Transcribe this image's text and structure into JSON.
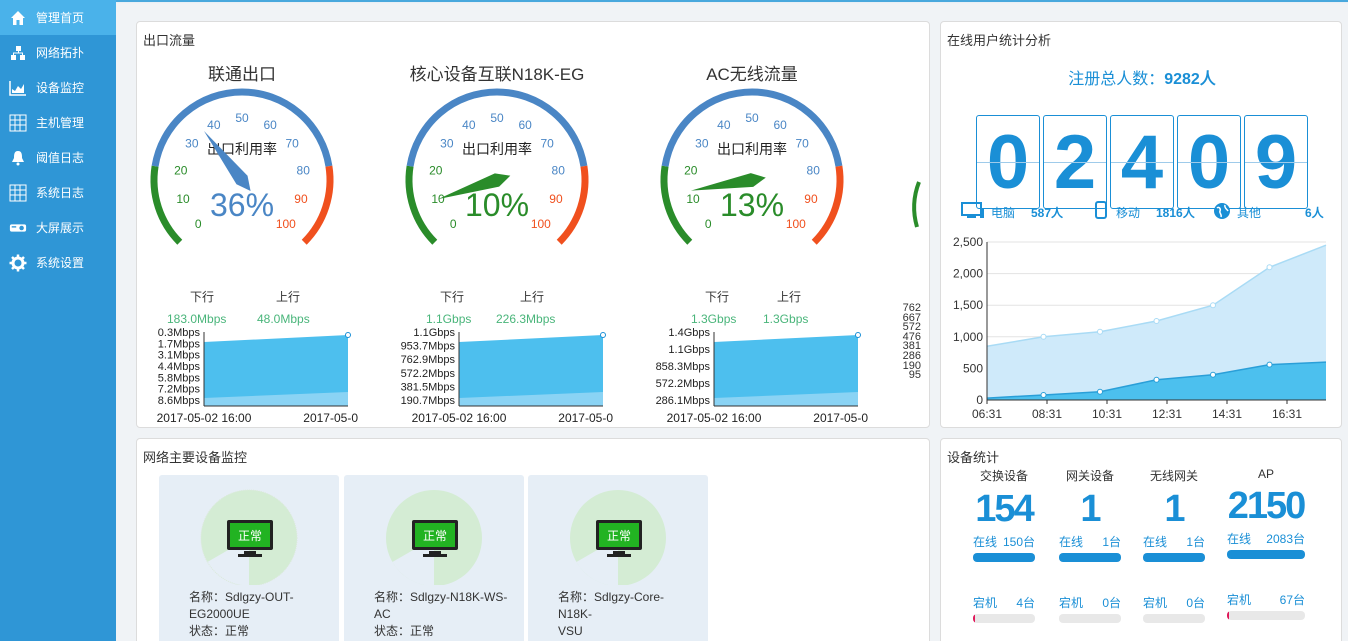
{
  "sidebar": {
    "items": [
      {
        "label": "管理首页",
        "icon": "home-icon",
        "active": true
      },
      {
        "label": "网络拓扑",
        "icon": "topology-icon"
      },
      {
        "label": "设备监控",
        "icon": "chart-icon"
      },
      {
        "label": "主机管理",
        "icon": "grid-icon"
      },
      {
        "label": "阈值日志",
        "icon": "bell-icon"
      },
      {
        "label": "系统日志",
        "icon": "grid-icon"
      },
      {
        "label": "大屏展示",
        "icon": "projector-icon"
      },
      {
        "label": "系统设置",
        "icon": "gear-icon"
      }
    ]
  },
  "outflow": {
    "title": "出口流量",
    "gauges": [
      {
        "title": "联通出口",
        "name": "出口利用率",
        "value": 36,
        "display": "36%",
        "color": "#4a86c5",
        "down_label": "下行",
        "up_label": "上行",
        "down": "183.0Mbps",
        "up": "48.0Mbps",
        "y_ticks": [
          "0.3Mbps",
          "1.7Mbps",
          "3.1Mbps",
          "4.4Mbps",
          "5.8Mbps",
          "7.2Mbps",
          "8.6Mbps"
        ],
        "x_start": "2017-05-02 16:00",
        "x_end": "2017-05-0"
      },
      {
        "title": "核心设备互联N18K-EG",
        "name": "出口利用率",
        "value": 10,
        "display": "10%",
        "color": "#2a8c2a",
        "down_label": "下行",
        "up_label": "上行",
        "down": "1.1Gbps",
        "up": "226.3Mbps",
        "y_ticks": [
          "1.1Gbps",
          "953.7Mbps",
          "762.9Mbps",
          "572.2Mbps",
          "381.5Mbps",
          "190.7Mbps"
        ],
        "x_start": "2017-05-02 16:00",
        "x_end": "2017-05-0"
      },
      {
        "title": "AC无线流量",
        "name": "出口利用率",
        "value": 13,
        "display": "13%",
        "color": "#2a8c2a",
        "down_label": "下行",
        "up_label": "上行",
        "down": "1.3Gbps",
        "up": "1.3Gbps",
        "y_ticks": [
          "1.4Gbps",
          "1.1Gbps",
          "858.3Mbps",
          "572.2Mbps",
          "286.1Mbps"
        ],
        "x_start": "2017-05-02 16:00",
        "x_end": "2017-05-0"
      }
    ],
    "partial_ticks": [
      "762",
      "667",
      "572",
      "476",
      "381",
      "286",
      "190",
      "95"
    ],
    "scale_labels": [
      "0",
      "10",
      "20",
      "30",
      "40",
      "50",
      "60",
      "70",
      "80",
      "90",
      "100"
    ]
  },
  "online": {
    "title": "在线用户统计分析",
    "registered_label": "注册总人数：",
    "registered_value": "9282人",
    "digits": [
      "0",
      "2",
      "4",
      "0",
      "9"
    ],
    "breakdown": [
      {
        "label": "电脑",
        "value": "587人",
        "icon": "computer-icon"
      },
      {
        "label": "移动",
        "value": "1816人",
        "icon": "phone-icon"
      },
      {
        "label": "其他",
        "value": "6人",
        "icon": "globe-icon"
      }
    ],
    "chart_data": {
      "type": "area",
      "x": [
        "06:31",
        "08:31",
        "10:31",
        "12:31",
        "14:31",
        "16:31"
      ],
      "y_ticks": [
        "0",
        "500",
        "1,000",
        "1,500",
        "2,000",
        "2,500"
      ],
      "ylim": [
        0,
        2500
      ],
      "series": [
        {
          "values": [
            850,
            1000,
            1080,
            1250,
            1500,
            2100,
            2450
          ]
        },
        {
          "values": [
            30,
            80,
            130,
            320,
            400,
            560,
            600
          ]
        }
      ]
    }
  },
  "monitor": {
    "title": "网络主要设备监控",
    "devices": [
      {
        "status_badge": "正常",
        "name_line1": "名称：Sdlgzy-OUT-",
        "name_line2": "EG2000UE",
        "state": "状态：正常"
      },
      {
        "status_badge": "正常",
        "name_line1": "名称：Sdlgzy-N18K-WS-",
        "name_line2": "AC",
        "state": "状态：正常"
      },
      {
        "status_badge": "正常",
        "name_line1": "名称：Sdlgzy-Core-N18K-",
        "name_line2": "VSU",
        "state": "状态：正常"
      }
    ]
  },
  "devstats": {
    "title": "设备统计",
    "items": [
      {
        "label": "交换设备",
        "count": "154",
        "online_label": "在线",
        "online": "150台",
        "down_label": "宕机",
        "down": "4台",
        "down_ratio": 0.026
      },
      {
        "label": "网关设备",
        "count": "1",
        "online_label": "在线",
        "online": "1台",
        "down_label": "宕机",
        "down": "0台",
        "down_ratio": 0
      },
      {
        "label": "无线网关",
        "count": "1",
        "online_label": "在线",
        "online": "1台",
        "down_label": "宕机",
        "down": "0台",
        "down_ratio": 0
      },
      {
        "label": "AP",
        "count": "2150",
        "online_label": "在线",
        "online": "2083台",
        "down_label": "宕机",
        "down": "67台",
        "down_ratio": 0.031
      }
    ]
  }
}
